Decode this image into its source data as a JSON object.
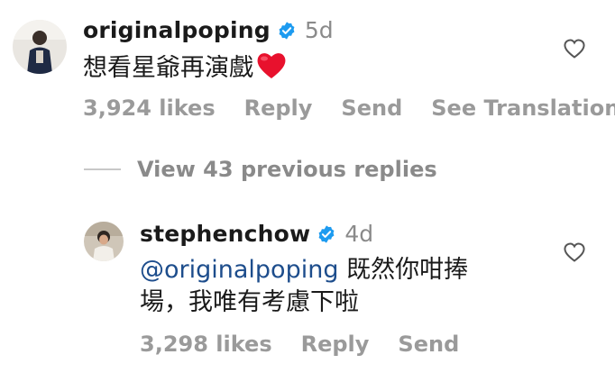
{
  "comment": {
    "avatar": "avatar-originalpoping",
    "username": "originalpoping",
    "verified_icon": "verified-badge-icon",
    "age": "5d",
    "text": "想看星爺再演戲",
    "emoji": "red-heart-emoji",
    "likes": "3,924 likes",
    "reply_label": "Reply",
    "send_label": "Send",
    "translation_label": "See Translation",
    "like_icon": "heart-outline-icon"
  },
  "view_replies": "View 43 previous replies",
  "reply": {
    "avatar": "avatar-stephenchow",
    "username": "stephenchow",
    "verified_icon": "verified-badge-icon",
    "age": "4d",
    "mention": "@originalpoping",
    "text_line1_rest": " 既然你咁捧",
    "text_line2": "場，我唯有考慮下啦",
    "likes": "3,298 likes",
    "reply_label": "Reply",
    "send_label": "Send",
    "like_icon": "heart-outline-icon"
  },
  "colors": {
    "text": "#1a1a1a",
    "muted": "#9a9a9a",
    "verified": "#1d9bf0",
    "mention": "#1d4d8c",
    "heart": "#e8112d"
  }
}
